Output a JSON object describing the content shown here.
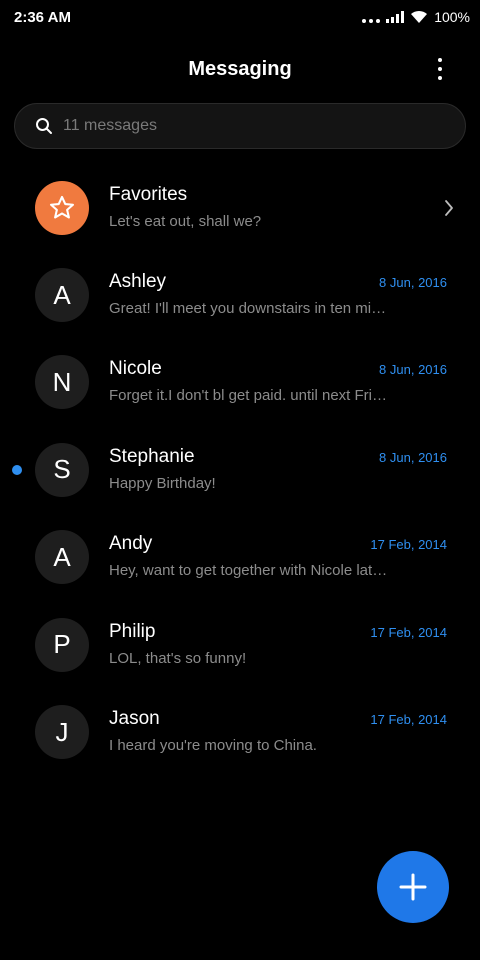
{
  "status_bar": {
    "time": "2:36 AM",
    "battery": "100%"
  },
  "header": {
    "title": "Messaging"
  },
  "search": {
    "placeholder": "11 messages"
  },
  "colors": {
    "accent": "#2f8ff0",
    "favorites_avatar": "#f07a3f",
    "fab": "#1f78e8"
  },
  "conversations": [
    {
      "name": "Favorites",
      "preview": "Let's eat out, shall we?",
      "date": "",
      "avatar": "star-icon",
      "unread": false
    },
    {
      "name": "Ashley",
      "preview": "Great! I'll meet you downstairs in ten minutes.",
      "date": "8 Jun, 2016",
      "avatar": "A",
      "unread": false
    },
    {
      "name": "Nicole",
      "preview": "Forget it.I don't bl get paid. until next Friday.",
      "date": "8 Jun, 2016",
      "avatar": "N",
      "unread": false
    },
    {
      "name": "Stephanie",
      "preview": "Happy Birthday!",
      "date": "8 Jun, 2016",
      "avatar": "S",
      "unread": true
    },
    {
      "name": "Andy",
      "preview": "Hey, want to get together with Nicole later?",
      "date": "17 Feb, 2014",
      "avatar": "A",
      "unread": false
    },
    {
      "name": "Philip",
      "preview": "LOL, that's so funny!",
      "date": "17 Feb, 2014",
      "avatar": "P",
      "unread": false
    },
    {
      "name": "Jason",
      "preview": "I heard you're moving to China.",
      "date": "17 Feb, 2014",
      "avatar": "J",
      "unread": false
    }
  ]
}
